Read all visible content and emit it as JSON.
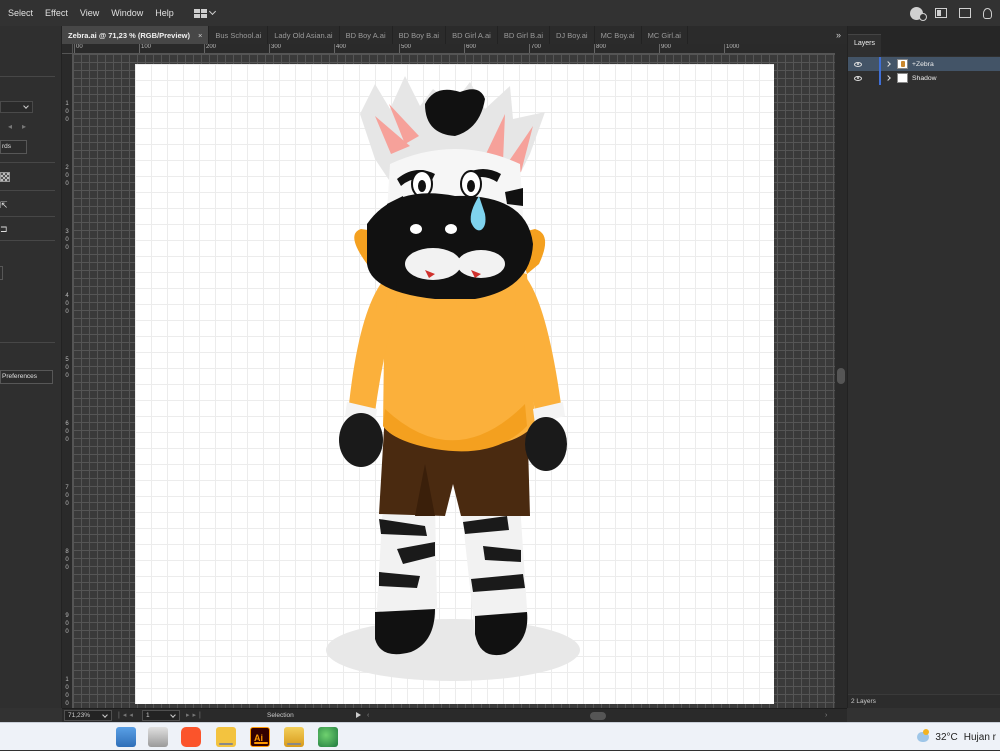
{
  "menu": {
    "items": [
      "Select",
      "Effect",
      "View",
      "Window",
      "Help"
    ]
  },
  "tabs": [
    {
      "label": "Zebra.ai @ 71,23 % (RGB/Preview)",
      "active": true,
      "close": "×"
    },
    {
      "label": "Bus School.ai",
      "active": false
    },
    {
      "label": "Lady Old Asian.ai",
      "active": false
    },
    {
      "label": "BD Boy A.ai",
      "active": false
    },
    {
      "label": "BD Boy B.ai",
      "active": false
    },
    {
      "label": "BD Girl A.ai",
      "active": false
    },
    {
      "label": "BD Girl B.ai",
      "active": false
    },
    {
      "label": "DJ Boy.ai",
      "active": false
    },
    {
      "label": "MC Boy.ai",
      "active": false
    },
    {
      "label": "MC Girl.ai",
      "active": false
    }
  ],
  "tab_overflow": "»",
  "left_panel": {
    "artboards_button": "rds",
    "preferences_button": "Preferences"
  },
  "ruler": {
    "h_labels": [
      "00",
      "100",
      "200",
      "300",
      "400",
      "500",
      "600",
      "700",
      "800",
      "900",
      "1000"
    ],
    "v_labels": [
      "1\n0\n0",
      "2\n0\n0",
      "3\n0\n0",
      "4\n0\n0",
      "5\n0\n0",
      "6\n0\n0",
      "7\n0\n0",
      "8\n0\n0",
      "9\n0\n0",
      "1\n0\n0\n0"
    ]
  },
  "layers_panel": {
    "tab_label": "Layers",
    "layers": [
      {
        "name": "+Zebra",
        "selected": true
      },
      {
        "name": "Shadow",
        "selected": false
      }
    ],
    "footer": "2 Layers"
  },
  "status": {
    "zoom": "71,23%",
    "page": "1",
    "tool": "Selection"
  },
  "taskbar": {
    "temperature": "32°C",
    "weather_text": "Hujan r"
  },
  "colors": {
    "hoodie": "#fbb03b",
    "shorts": "#4a2a10",
    "selection": "#435467",
    "layer_color": "#3f6fd6"
  },
  "icons": [
    "workspace-switcher-icon",
    "account-icon",
    "arrange-documents-icon",
    "window-icon",
    "discover-icon",
    "eye-icon",
    "expand-icon",
    "weather-icon"
  ]
}
